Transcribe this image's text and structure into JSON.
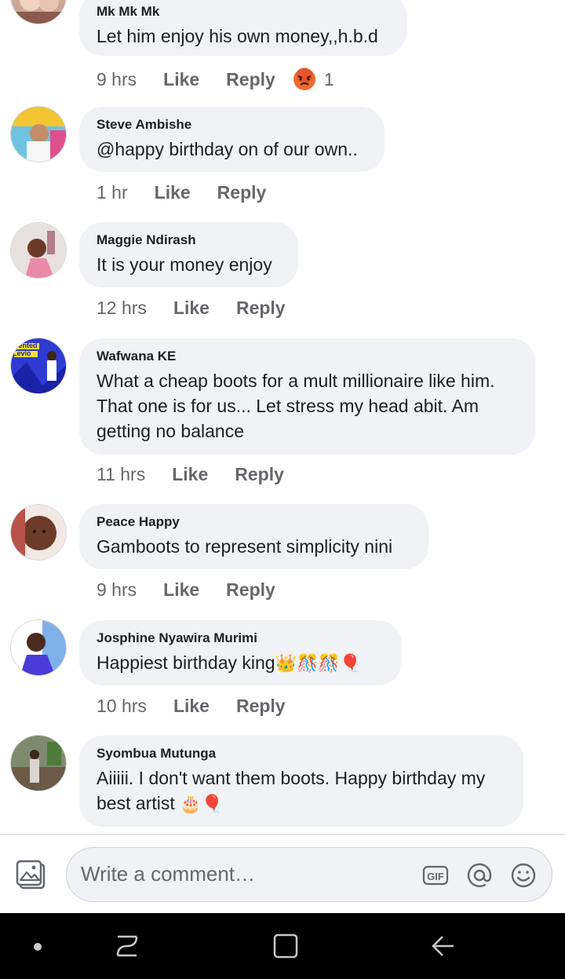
{
  "comments": [
    {
      "author": "Mk Mk Mk",
      "text": "Let him enjoy his own money,,h.b.d",
      "time": "9 hrs",
      "like": "Like",
      "reply": "Reply",
      "reaction_count": "1"
    },
    {
      "author": "Steve Ambishe",
      "text": "@happy birthday on of our own..",
      "time": "1 hr",
      "like": "Like",
      "reply": "Reply"
    },
    {
      "author": "Maggie Ndirash",
      "text": "It is your money enjoy",
      "time": "12 hrs",
      "like": "Like",
      "reply": "Reply"
    },
    {
      "author": "Wafwana KE",
      "text": "What a cheap boots for a mult millionaire like him. That one is for us... Let stress my head abit. Am getting no balance",
      "time": "11 hrs",
      "like": "Like",
      "reply": "Reply",
      "avatar_text": "alented Levio"
    },
    {
      "author": "Peace Happy",
      "text": "Gamboots to represent simplicity nini",
      "time": "9 hrs",
      "like": "Like",
      "reply": "Reply"
    },
    {
      "author": "Josphine Nyawira Murimi",
      "text": "Happiest birthday king",
      "emoji": "👑🎊🎊🎈",
      "time": "10 hrs",
      "like": "Like",
      "reply": "Reply"
    },
    {
      "author": "Syombua Mutunga",
      "text": "Aiiiii. I don't want them boots. Happy birthday my best artist",
      "emoji": "🎂🎈"
    }
  ],
  "composer": {
    "placeholder": "Write a comment…",
    "icons": [
      "photo-icon",
      "gif-icon",
      "mention-icon",
      "emoji-icon"
    ]
  },
  "navbar": {
    "icons": [
      "dot-icon",
      "recents-icon",
      "home-icon",
      "back-icon"
    ]
  },
  "colors": {
    "bubble": "#f0f2f5",
    "meta": "#65676b",
    "text": "#1c1e21"
  }
}
